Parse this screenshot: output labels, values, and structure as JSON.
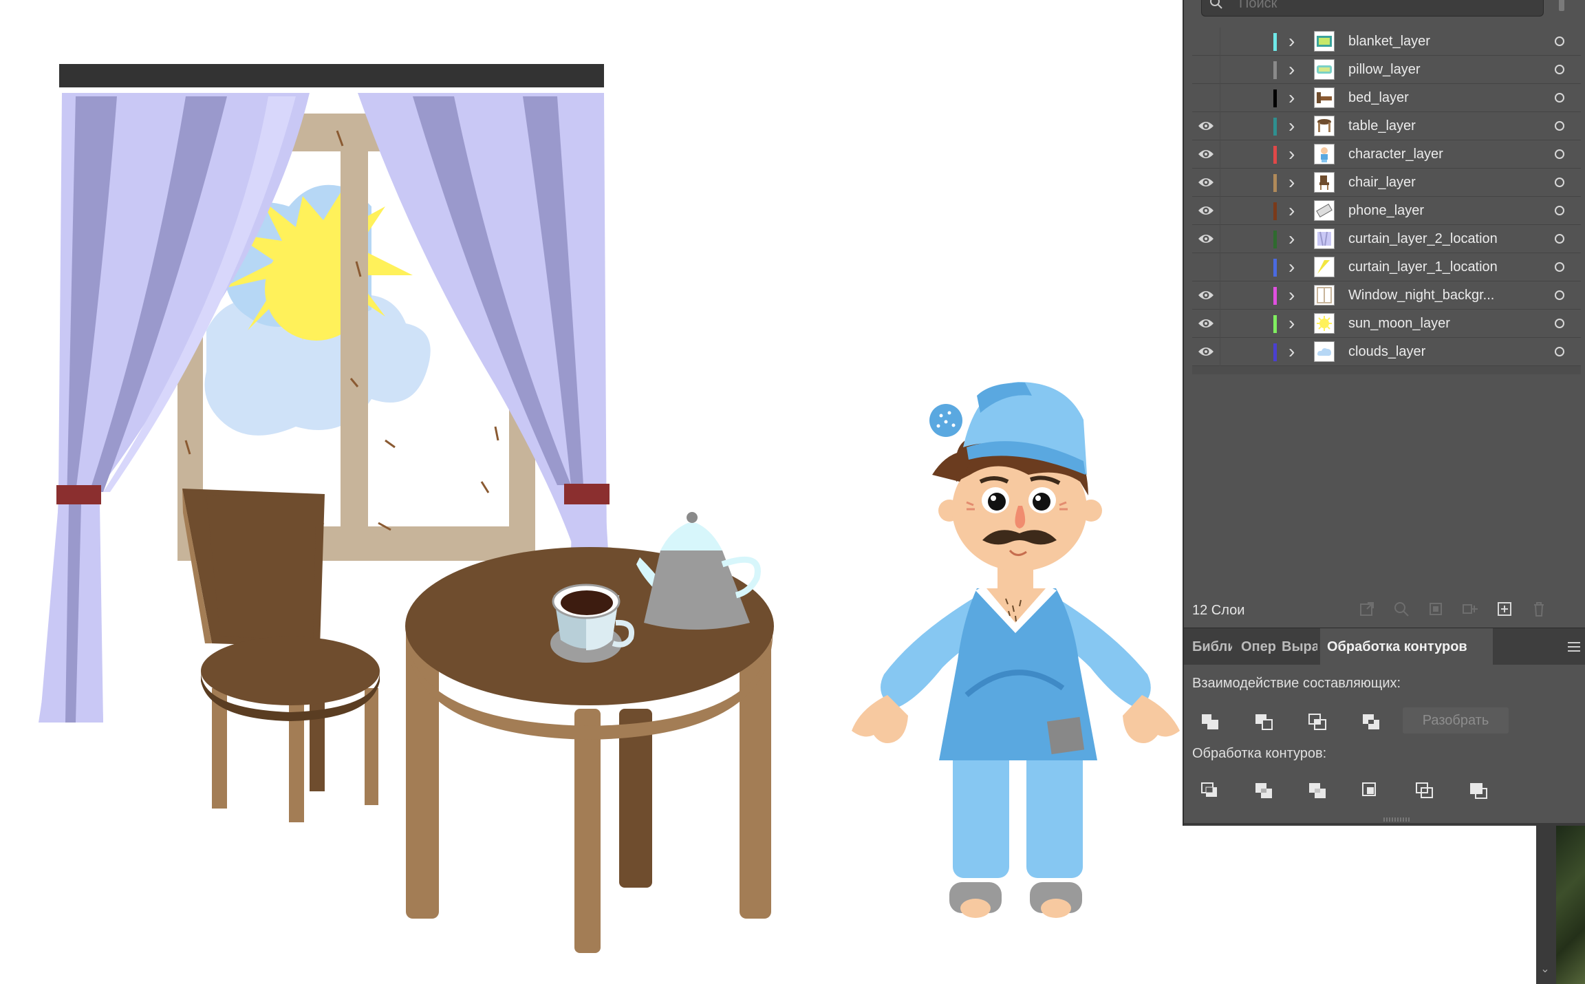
{
  "search": {
    "placeholder": "Поиск"
  },
  "layers": [
    {
      "name": "blanket_layer",
      "color": "#6fe8e8",
      "visible": false,
      "thumb": "blanket"
    },
    {
      "name": "pillow_layer",
      "color": "#8a8a8a",
      "visible": false,
      "thumb": "pillow"
    },
    {
      "name": "bed_layer",
      "color": "#000000",
      "visible": false,
      "thumb": "bed"
    },
    {
      "name": "table_layer",
      "color": "#2f8f8f",
      "visible": true,
      "thumb": "table"
    },
    {
      "name": "character_layer",
      "color": "#e04848",
      "visible": true,
      "thumb": "character"
    },
    {
      "name": "chair_layer",
      "color": "#b08a5a",
      "visible": true,
      "thumb": "chair"
    },
    {
      "name": "phone_layer",
      "color": "#7a3a1a",
      "visible": true,
      "thumb": "phone"
    },
    {
      "name": "curtain_layer_2_location",
      "color": "#2f6a2f",
      "visible": true,
      "thumb": "curtain"
    },
    {
      "name": "curtain_layer_1_location",
      "color": "#4a6ae0",
      "visible": false,
      "thumb": "curtain-yellow"
    },
    {
      "name": "Window_night_backgr...",
      "color": "#e050e0",
      "visible": true,
      "thumb": "window"
    },
    {
      "name": "sun_moon_layer",
      "color": "#80ee60",
      "visible": true,
      "thumb": "sun"
    },
    {
      "name": "clouds_layer",
      "color": "#4a40d0",
      "visible": true,
      "thumb": "clouds"
    }
  ],
  "layers_footer": {
    "count_label": "12 Слои"
  },
  "tabs": [
    {
      "label": "Библи",
      "active": false
    },
    {
      "label": "Опера",
      "active": false
    },
    {
      "label": "Вырав",
      "active": false
    },
    {
      "label": "Обработка контуров",
      "active": true
    }
  ],
  "pathfinder": {
    "shape_modes_label": "Взаимодействие составляющих:",
    "expand_label": "Разобрать",
    "pathfinders_label": "Обработка контуров:"
  },
  "icons": {
    "search": "search-icon",
    "eye": "eye-icon",
    "chevron": "chevron-right-icon",
    "target": "target-circle-icon",
    "menu": "panel-menu-icon"
  },
  "colors": {
    "panel_bg": "#535353",
    "panel_dark": "#3e3e3e",
    "curtain": "#c9c8f5",
    "curtain_shadow": "#9a99cc",
    "wood": "#6f4d2e",
    "wood_light": "#a37d55",
    "window_frame": "#c7b49a",
    "sun": "#fff15a",
    "pajama": "#5aa8e0",
    "pajama_light": "#86c7f2",
    "skin": "#f7c9a0"
  }
}
